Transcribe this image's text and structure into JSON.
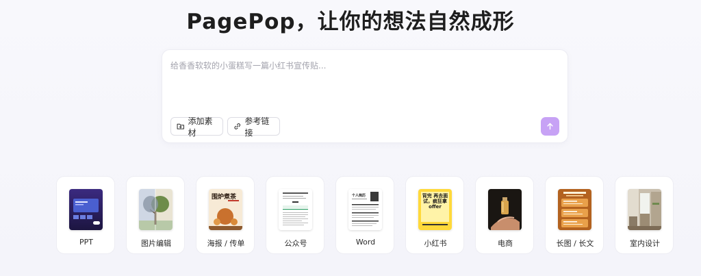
{
  "title": "PagePop，让你的想法自然成形",
  "composer": {
    "placeholder": "给香香软软的小蛋糕写一篇小红书宣传贴...",
    "add_material_label": "添加素材",
    "reference_link_label": "参考链接"
  },
  "accent_color": "#c7a2f5",
  "categories": [
    {
      "label": "PPT",
      "thumb": "ppt-thumbnail"
    },
    {
      "label": "图片编辑",
      "thumb": "tree-thumbnail"
    },
    {
      "label": "海报 / 传单",
      "thumb": "tea-poster-thumbnail",
      "thumb_text": "围炉煮茶"
    },
    {
      "label": "公众号",
      "thumb": "article-thumbnail"
    },
    {
      "label": "Word",
      "thumb": "resume-thumbnail",
      "thumb_text": "个人简历"
    },
    {
      "label": "小红书",
      "thumb": "xiaohongshu-thumbnail",
      "thumb_text": "背完 再去面试，疯狂拿 offer"
    },
    {
      "label": "电商",
      "thumb": "perfume-thumbnail"
    },
    {
      "label": "长图 / 长文",
      "thumb": "long-image-thumbnail"
    },
    {
      "label": "室内设计",
      "thumb": "interior-thumbnail"
    }
  ]
}
